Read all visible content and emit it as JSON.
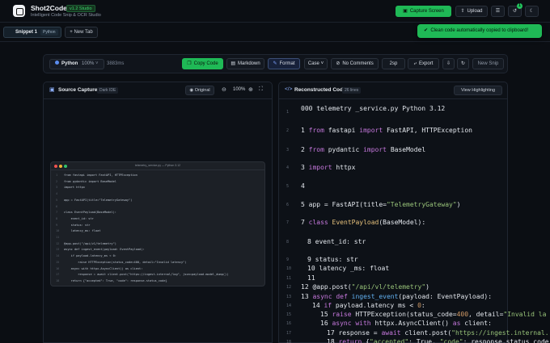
{
  "header": {
    "app_title": "Shot2Code",
    "version": "v1.2 Studio",
    "subtitle": "Intelligent Code Snip & OCR Studio",
    "capture_label": "Capture Screen",
    "upload_label": "Upload",
    "notification_count": "1"
  },
  "tabs": {
    "active_label": "Snippet 1",
    "active_tag": "Python",
    "new_tab_label": "+ New Tab"
  },
  "toast": {
    "message": "Clean code automatically copied to clipboard!"
  },
  "toolbar": {
    "language": "Python",
    "confidence": "100%",
    "duration": "3883ms",
    "copy_label": "Copy Code",
    "markdown_label": "Markdown",
    "format_label": "Format",
    "case_label": "Case",
    "no_comments_label": "No Comments",
    "zoom_label": "2sp",
    "export_label": "Export",
    "new_snip_label": "New Snip"
  },
  "source_panel": {
    "title": "Source Capture",
    "tag": "Dark IDE",
    "original_label": "Original",
    "zoom": "100%",
    "snippet_window_title": "telemetry_service.py — Python 3.12",
    "snippet_lines": [
      {
        "n": "1",
        "t": "from fastapi import FastAPI, HTTPException"
      },
      {
        "n": "2",
        "t": "from pydantic import BaseModel"
      },
      {
        "n": "3",
        "t": "import httpx"
      },
      {
        "n": "4",
        "t": ""
      },
      {
        "n": "5",
        "t": "app = FastAPI(title=\"TelemetryGateway\")"
      },
      {
        "n": "6",
        "t": ""
      },
      {
        "n": "7",
        "t": "class EventPayload(BaseModel):"
      },
      {
        "n": "8",
        "t": "    event_id: str"
      },
      {
        "n": "9",
        "t": "    status: str"
      },
      {
        "n": "10",
        "t": "    latency_ms: float"
      },
      {
        "n": "11",
        "t": ""
      },
      {
        "n": "12",
        "t": "@app.post(\"/api/v1/telemetry\")"
      },
      {
        "n": "13",
        "t": "async def ingest_event(payload: EventPayload):"
      },
      {
        "n": "14",
        "t": "    if payload.latency_ms < 0:"
      },
      {
        "n": "15",
        "t": "        raise HTTPException(status_code=400, detail=\"Invalid latency\")"
      },
      {
        "n": "16",
        "t": "    async with httpx.AsyncClient() as client:"
      },
      {
        "n": "17",
        "t": "        response = await client.post(\"https://ingest.internal/log\", json=payload.model_dump())"
      },
      {
        "n": "18",
        "t": "    return {\"accepted\": True, \"code\": response.status_code}"
      }
    ]
  },
  "code_panel": {
    "title": "Reconstructed Code",
    "lines_tag": "26 lines",
    "view_highlighting_label": "View Highlighting",
    "header_line": "000 telemetry _service.py Python 3.12",
    "lines": [
      {
        "n": "1",
        "parts": [
          [
            "kw",
            "from "
          ],
          [
            "",
            "fastapi "
          ],
          [
            "kw",
            "import "
          ],
          [
            "",
            "FastAPI, HTTPException"
          ]
        ]
      },
      {
        "n": "2",
        "parts": [
          [
            "kw",
            "from "
          ],
          [
            "",
            "pydantic "
          ],
          [
            "kw",
            "import "
          ],
          [
            "",
            "BaseModel"
          ]
        ]
      },
      {
        "n": "3",
        "parts": [
          [
            "kw",
            "import "
          ],
          [
            "",
            "httpx"
          ]
        ]
      },
      {
        "n": "4",
        "parts": [
          [
            "",
            ""
          ]
        ]
      },
      {
        "n": "5",
        "parts": [
          [
            "",
            "app = FastAPI(title="
          ],
          [
            "st",
            "\"TelemetryGateway\""
          ],
          [
            "",
            ")"
          ]
        ]
      },
      {
        "n": "7",
        "parts": [
          [
            "kw",
            "class "
          ],
          [
            "ty",
            "EventPayload"
          ],
          [
            "",
            "(BaseModel):"
          ]
        ]
      },
      {
        "n": "8",
        "parts": [
          [
            "",
            "event_id: str"
          ]
        ]
      },
      {
        "n": "9",
        "parts": [
          [
            "",
            "status: str"
          ]
        ]
      },
      {
        "n": "10",
        "parts": [
          [
            "",
            "latency _ms: float"
          ]
        ]
      },
      {
        "n": "11",
        "parts": [
          [
            "",
            ""
          ]
        ]
      },
      {
        "n": "12",
        "parts": [
          [
            "",
            "@app.post("
          ],
          [
            "st",
            "\"/api/vl/telemetry\""
          ],
          [
            "",
            ")"
          ]
        ]
      },
      {
        "n": "13",
        "parts": [
          [
            "kw",
            "async def "
          ],
          [
            "fn",
            "ingest_event"
          ],
          [
            "",
            "(payload: EventPayload):"
          ]
        ]
      },
      {
        "n": "14",
        "parts": [
          [
            "kw",
            "if "
          ],
          [
            "",
            "payload.latency ms < "
          ],
          [
            "nu",
            "0"
          ],
          [
            "",
            ":"
          ]
        ]
      },
      {
        "n": "15",
        "parts": [
          [
            "kw",
            "raise "
          ],
          [
            "",
            "HTTPException(status_code="
          ],
          [
            "nu",
            "400"
          ],
          [
            "",
            ", detail="
          ],
          [
            "st",
            "\"Invalid la"
          ]
        ]
      },
      {
        "n": "16",
        "parts": [
          [
            "kw",
            "async with "
          ],
          [
            "",
            "httpx.AsyncClient() "
          ],
          [
            "kw",
            "as "
          ],
          [
            "",
            "client:"
          ]
        ]
      },
      {
        "n": "17",
        "parts": [
          [
            "",
            "response = "
          ],
          [
            "kw",
            "await "
          ],
          [
            "",
            "client.post("
          ],
          [
            "st",
            "\"https://ingest.internal."
          ]
        ]
      },
      {
        "n": "18",
        "parts": [
          [
            "kw",
            "return "
          ],
          [
            "",
            "{"
          ],
          [
            "st",
            "\"accepted\""
          ],
          [
            "",
            ": True, "
          ],
          [
            "st",
            "\"code\""
          ],
          [
            "",
            ": response.status_code"
          ]
        ]
      }
    ]
  },
  "colors": {
    "accent": "#1fb956",
    "background": "#0b0e13",
    "keyword": "#c678dd",
    "string": "#98c379"
  }
}
